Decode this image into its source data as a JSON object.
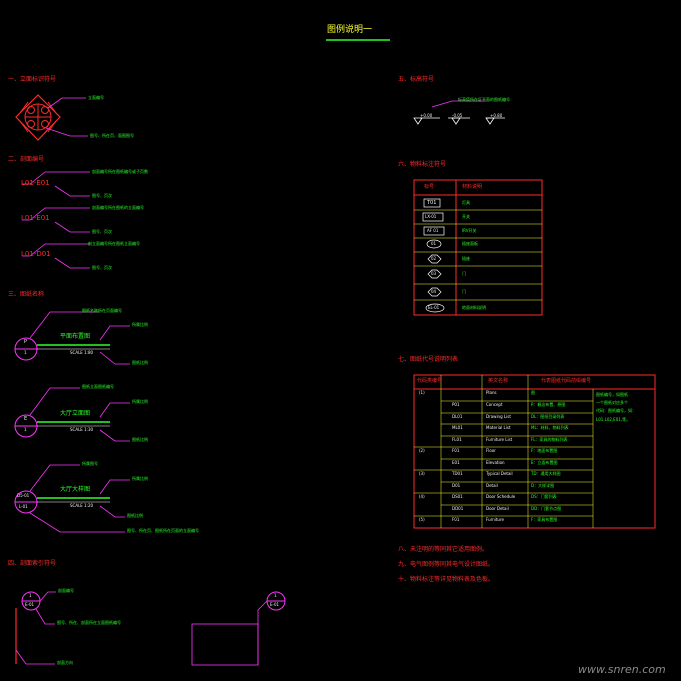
{
  "title": "图例说明一",
  "sec1": {
    "heading": "一、立面标识符号",
    "labels": [
      "立面编号",
      "图号、所在页、面图图号"
    ]
  },
  "sec2": {
    "heading": "二、剖面编号",
    "codes": [
      "L01-E01",
      "L01-E01",
      "L01-D01"
    ],
    "labels": [
      "剖面编号所在图纸编号或子页数",
      "图号、页次",
      "剖面编号所在图纸的立面编号",
      "图号、页次",
      "剖立面编号所在图纸立面编号",
      "图号、页次"
    ]
  },
  "sec3": {
    "heading": "三、图纸名称",
    "items": [
      {
        "code": "P",
        "num": "1",
        "name": "平面布置图",
        "scale": "SCALE   1:80",
        "notes": [
          "图纸名称所在页面编号",
          "所属比例",
          "图纸比例"
        ]
      },
      {
        "code": "E",
        "num": "1",
        "name": "大厅立面图",
        "scale": "SCALE   1:30",
        "notes": [
          "图纸立面图纸编号",
          "所属比例",
          "图纸比例"
        ]
      },
      {
        "code": "D5-01",
        "num": "L-01",
        "name": "大厅大样图",
        "scale": "SCALE   1:20",
        "notes": [
          "所属图号",
          "所属比例",
          "图纸比例",
          "图号、所在页、图纸所在页面的立面编号"
        ]
      }
    ]
  },
  "sec4": {
    "heading": "四、剖面索引符号",
    "tag_top": "1",
    "tag_bottom": "E-01",
    "tag2_top": "1",
    "tag2_bottom": "E-01",
    "labels": [
      "剖面编号",
      "图号、所在、剖面所在立面图纸编号",
      "剖面方向"
    ]
  },
  "sec5": {
    "heading": "五、标高符号",
    "note": "标高值所在区平面的图纸编号",
    "marks": [
      "+0.00",
      "-0.05",
      "+0.80"
    ]
  },
  "sec6": {
    "heading": "六、物料标注符号",
    "headers": [
      "标号",
      "材料说明"
    ],
    "rows": [
      {
        "code": "T01",
        "desc": "灯具"
      },
      {
        "code": "LX-01",
        "desc": "开关"
      },
      {
        "code": "AF 01",
        "desc": "IRV开关"
      },
      {
        "code": "01",
        "desc": "插座面板"
      },
      {
        "code": "02",
        "desc": "插座"
      },
      {
        "code": "03",
        "desc": "门"
      },
      {
        "code": "04",
        "desc": "门"
      },
      {
        "code": "EL-01",
        "desc": "地面材料说明"
      }
    ]
  },
  "sec7": {
    "heading": "七、图纸代号说明列表",
    "headers": [
      "代码类编号",
      "英文名称",
      "代表图纸代码前缀编号"
    ],
    "side_note": [
      "图纸编号，如图纸",
      "一个图纸对应多个",
      "代码：图纸编号，如：",
      "L01,L02,E01,等。"
    ],
    "rows": [
      {
        "grp": "(1)",
        "code": "",
        "en": "Plans",
        "cn": "图"
      },
      {
        "grp": "",
        "code": "P01",
        "en": "Concept",
        "cn": "P：概念布置、原图"
      },
      {
        "grp": "",
        "code": "DL01",
        "en": "Drawing List",
        "cn": "DL：图纸目录列表"
      },
      {
        "grp": "",
        "code": "ML01",
        "en": "Material List",
        "cn": "ML：材料、物料列表"
      },
      {
        "grp": "",
        "code": "FL01",
        "en": "Furniture List",
        "cn": "FL：家具的物料列表"
      },
      {
        "grp": "(2)",
        "code": "F01",
        "en": "Floor",
        "cn": "F：地面布置图"
      },
      {
        "grp": "",
        "code": "E01",
        "en": "Elevation",
        "cn": "E：立面布置图"
      },
      {
        "grp": "(3)",
        "code": "TD01",
        "en": "Typical Detail",
        "cn": "TD：通用大样图"
      },
      {
        "grp": "",
        "code": "D01",
        "en": "Detail",
        "cn": "D：大样详图"
      },
      {
        "grp": "(4)",
        "code": "DS01",
        "en": "Door Schedule",
        "cn": "DS：门套列表"
      },
      {
        "grp": "",
        "code": "DD01",
        "en": "Door Detail",
        "cn": "DD：门套节点图"
      },
      {
        "grp": "(5)",
        "code": "F01",
        "en": "Furniture",
        "cn": "F：家具布置图"
      }
    ]
  },
  "notes": [
    "八、未注明的等同其它适用图例。",
    "九、电气图例等同其电气设计图纸。",
    "十、物料标注等详见物料表及色板。"
  ],
  "watermark": "www.snren.com"
}
